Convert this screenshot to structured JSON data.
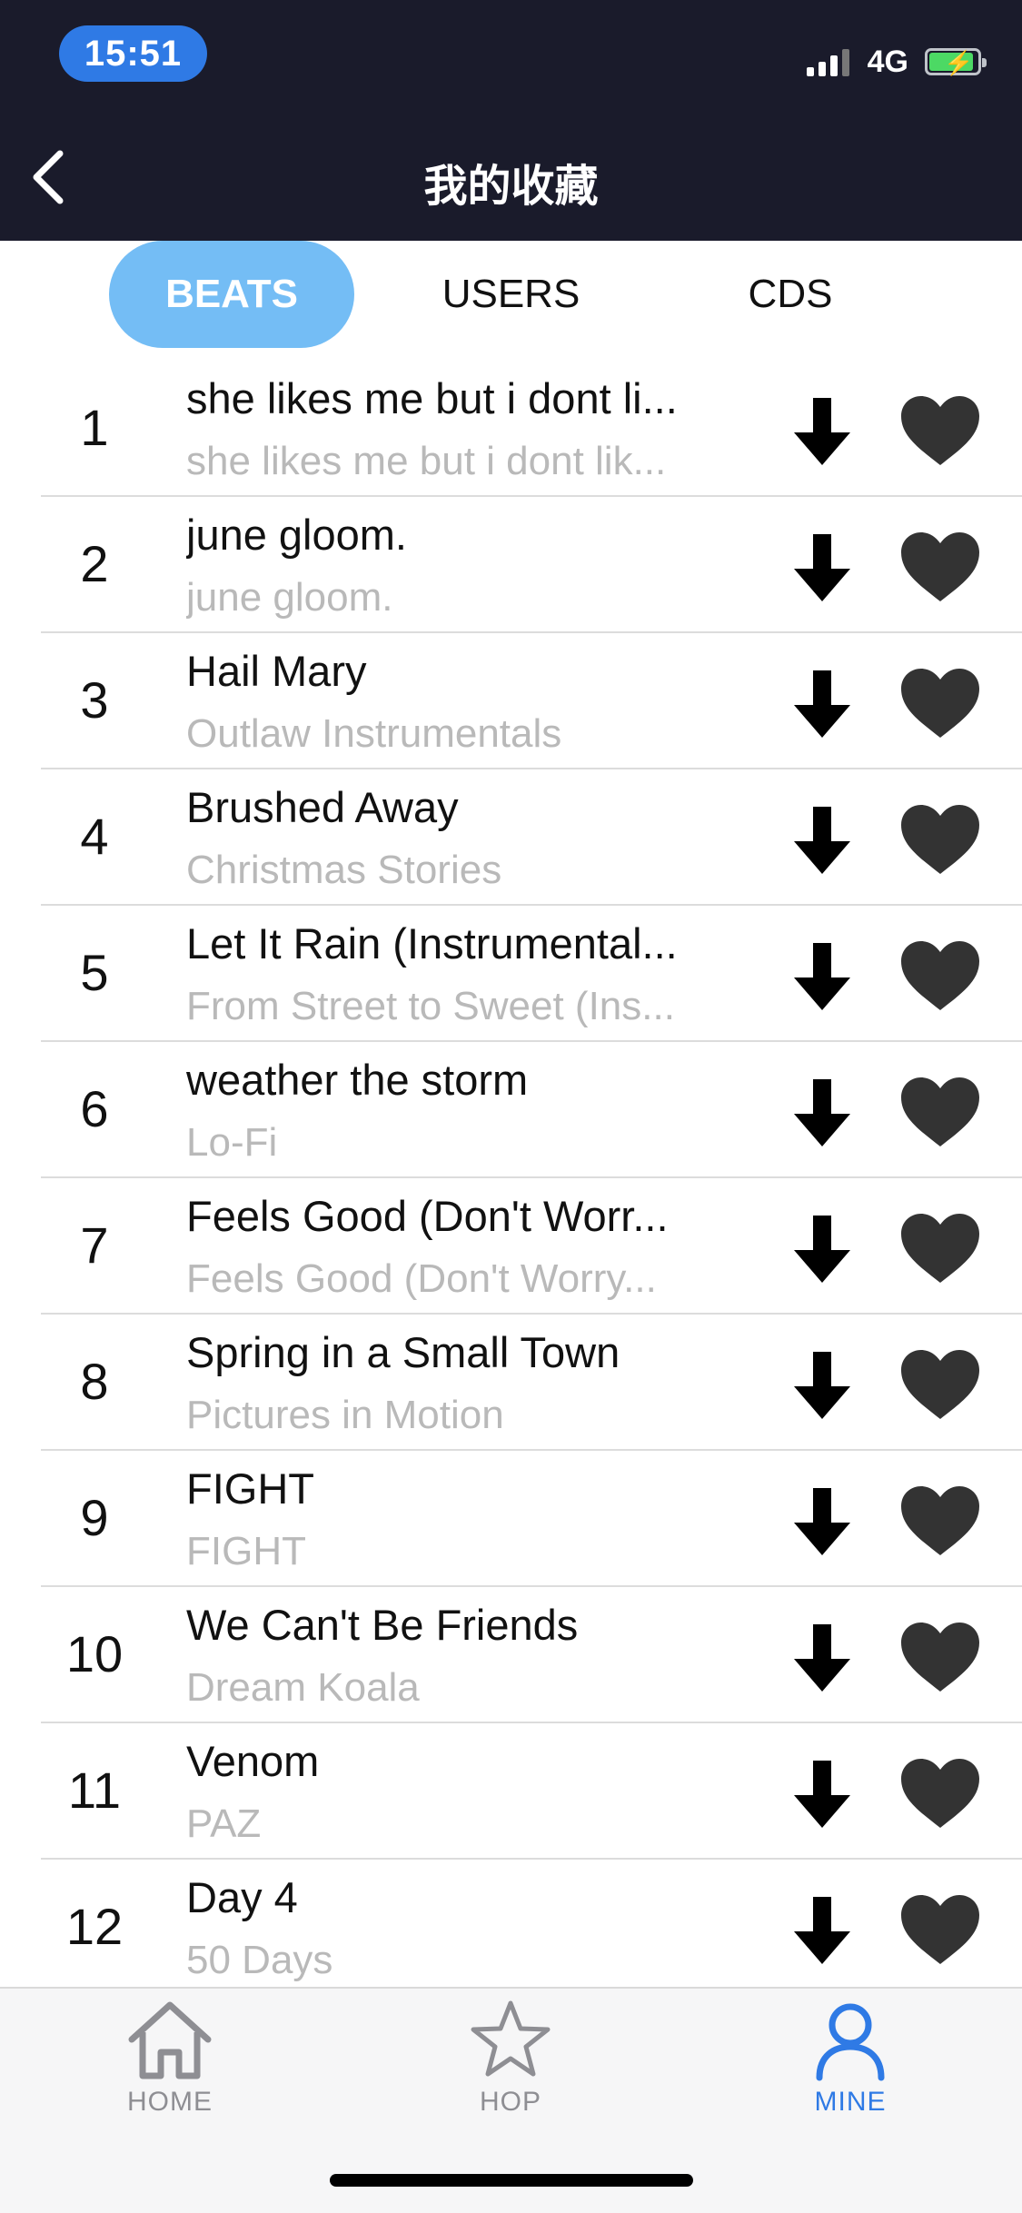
{
  "status_bar": {
    "time": "15:51",
    "network": "4G"
  },
  "header": {
    "title": "我的收藏",
    "back_icon": "chevron-left-icon"
  },
  "tabs": [
    {
      "label": "BEATS",
      "active": true
    },
    {
      "label": "USERS",
      "active": false
    },
    {
      "label": "CDS",
      "active": false
    }
  ],
  "list": [
    {
      "rank": "1",
      "title": "she likes me but i dont li...",
      "subtitle": "she likes me but i dont lik..."
    },
    {
      "rank": "2",
      "title": "june gloom.",
      "subtitle": "june gloom."
    },
    {
      "rank": "3",
      "title": "Hail Mary",
      "subtitle": "Outlaw Instrumentals"
    },
    {
      "rank": "4",
      "title": "Brushed Away",
      "subtitle": "Christmas Stories"
    },
    {
      "rank": "5",
      "title": "Let It Rain (Instrumental...",
      "subtitle": "From Street to Sweet (Ins..."
    },
    {
      "rank": "6",
      "title": "weather the storm",
      "subtitle": "Lo-Fi"
    },
    {
      "rank": "7",
      "title": "Feels Good (Don't Worr...",
      "subtitle": "Feels Good (Don't Worry..."
    },
    {
      "rank": "8",
      "title": "Spring in a Small Town",
      "subtitle": "Pictures in Motion"
    },
    {
      "rank": "9",
      "title": "FIGHT",
      "subtitle": "FIGHT"
    },
    {
      "rank": "10",
      "title": "We Can't Be Friends",
      "subtitle": "Dream Koala"
    },
    {
      "rank": "11",
      "title": "Venom",
      "subtitle": "PAZ"
    },
    {
      "rank": "12",
      "title": "Day 4",
      "subtitle": "50 Days"
    }
  ],
  "bottom_nav": [
    {
      "label": "HOME",
      "icon": "home-icon",
      "active": false
    },
    {
      "label": "HOP",
      "icon": "star-icon",
      "active": false
    },
    {
      "label": "MINE",
      "icon": "user-icon",
      "active": true
    }
  ],
  "colors": {
    "header_bg": "#1a1b2b",
    "tab_active_bg": "#74bdf5",
    "nav_active": "#2f7ae5",
    "nav_inactive": "#8e8e93",
    "subtitle": "#b9b9b9"
  }
}
